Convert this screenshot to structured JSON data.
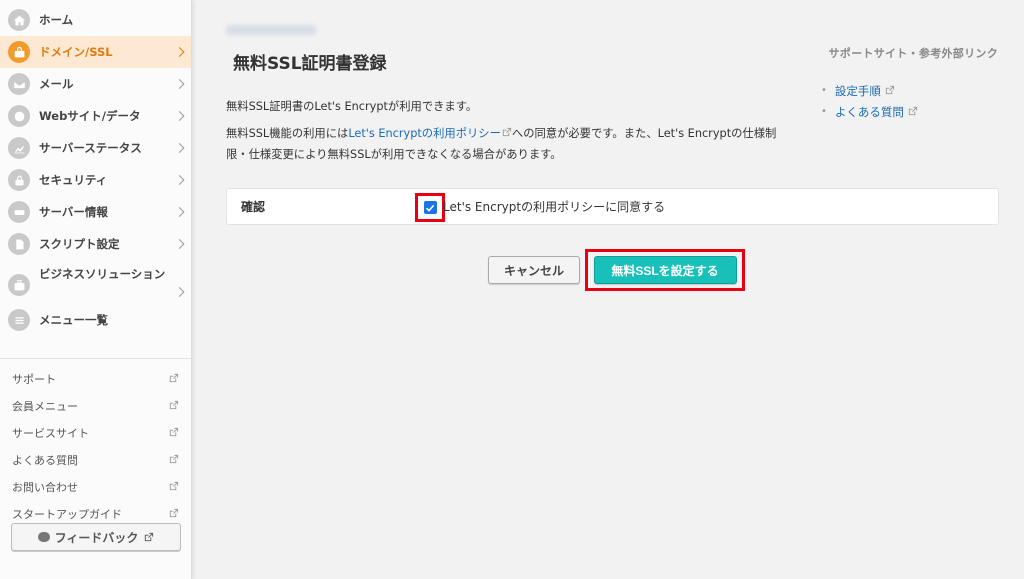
{
  "sidebar": {
    "nav": [
      {
        "label": "ホーム",
        "icon": "home-icon",
        "chevron": false,
        "active": false
      },
      {
        "label": "ドメイン/SSL",
        "icon": "domain-icon",
        "chevron": true,
        "active": true
      },
      {
        "label": "メール",
        "icon": "mail-icon",
        "chevron": true,
        "active": false
      },
      {
        "label": "Webサイト/データ",
        "icon": "globe-icon",
        "chevron": true,
        "active": false
      },
      {
        "label": "サーバーステータス",
        "icon": "status-chart-icon",
        "chevron": true,
        "active": false
      },
      {
        "label": "セキュリティ",
        "icon": "lock-icon",
        "chevron": true,
        "active": false
      },
      {
        "label": "サーバー情報",
        "icon": "server-icon",
        "chevron": true,
        "active": false
      },
      {
        "label": "スクリプト設定",
        "icon": "script-icon",
        "chevron": true,
        "active": false
      },
      {
        "label": "ビジネスソリューション",
        "icon": "briefcase-icon",
        "chevron": true,
        "active": false
      },
      {
        "label": "メニュー一覧",
        "icon": "list-icon",
        "chevron": false,
        "active": false
      }
    ],
    "links": [
      "サポート",
      "会員メニュー",
      "サービスサイト",
      "よくある質問",
      "お問い合わせ",
      "スタートアップガイド"
    ],
    "feedback_label": "フィードバック"
  },
  "main": {
    "title": "無料SSL証明書登録",
    "support_heading": "サポートサイト・参考外部リンク",
    "support_links": [
      "設定手順",
      "よくある質問"
    ],
    "desc1": "無料SSL証明書のLet's Encryptが利用できます。",
    "desc2_pre": "無料SSL機能の利用には",
    "desc2_link": "Let's Encryptの利用ポリシー",
    "desc2_post": "への同意が必要です。また、Let's Encryptの仕様制限・仕様変更により無料SSLが利用できなくなる場合があります。",
    "confirm_label": "確認",
    "confirm_text": "Let's Encryptの利用ポリシーに同意する",
    "confirm_checked": true,
    "cancel_label": "キャンセル",
    "submit_label": "無料SSLを設定する"
  },
  "colors": {
    "accent": "#f39a2c",
    "submit": "#19c0b9",
    "highlight": "#e60012",
    "link": "#1a6bb5"
  }
}
